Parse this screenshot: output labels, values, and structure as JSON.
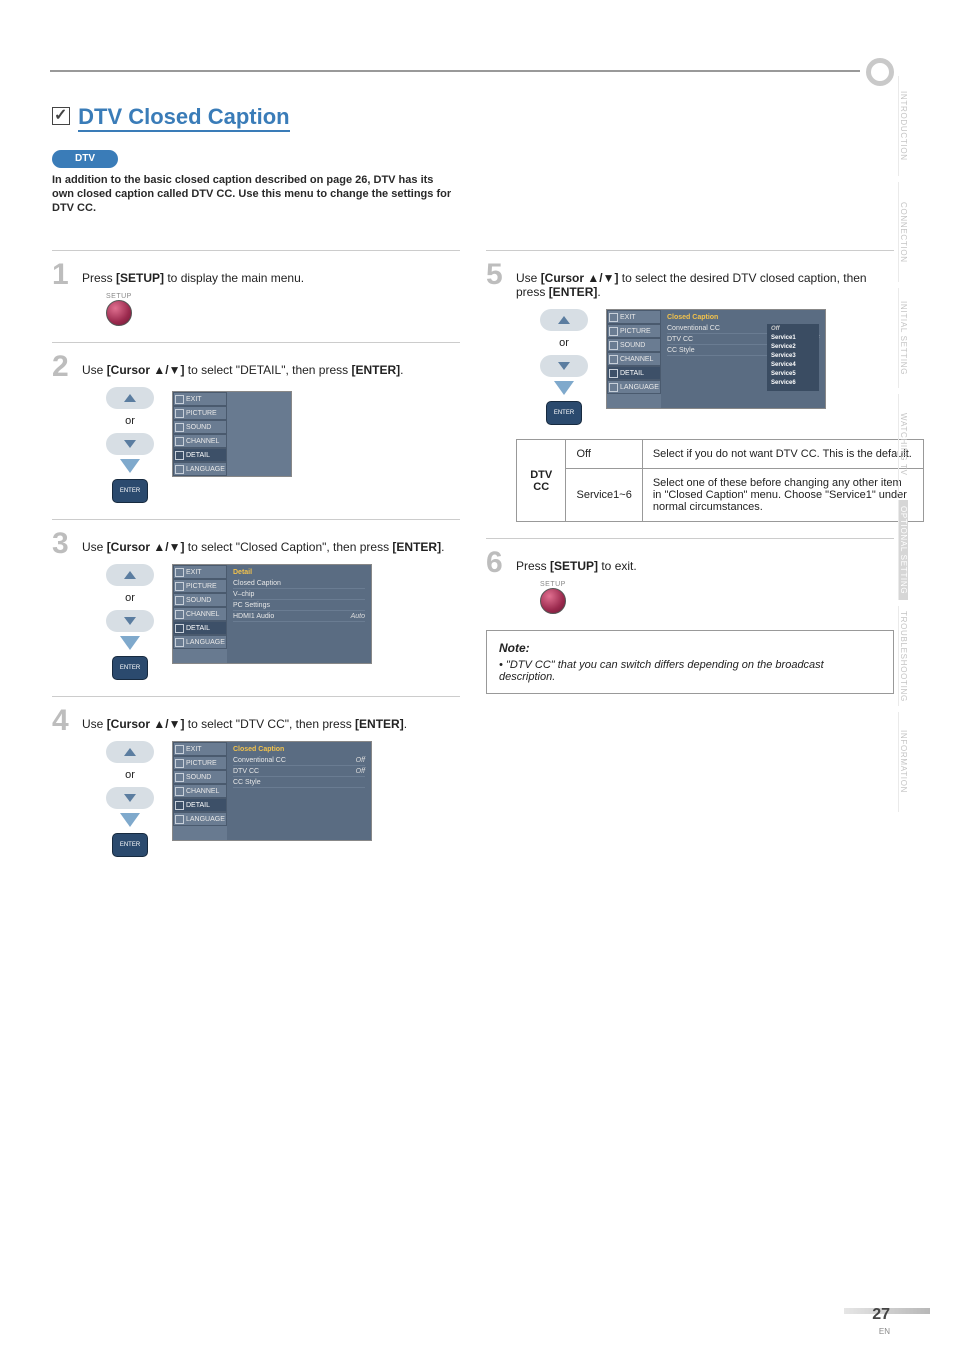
{
  "page": {
    "number": "27",
    "lang": "EN"
  },
  "title": {
    "prefix_icon": "checkbox",
    "text": "DTV Closed Caption"
  },
  "dtv_badge": "DTV",
  "intro": "In addition to the basic closed caption described on page 26, DTV has its own closed caption called DTV CC. Use this menu to change the settings for DTV CC.",
  "steps": {
    "s1": {
      "num": "1",
      "text_a": "Press ",
      "bold_a": "[SETUP]",
      "text_b": " to display the main menu.",
      "remote_label": "SETUP"
    },
    "s2": {
      "num": "2",
      "text_a": "Use ",
      "bold_a": "[Cursor ▲/▼]",
      "text_b": " to select \"DETAIL\", then press ",
      "bold_b": "[ENTER]",
      "tail": "."
    },
    "s3": {
      "num": "3",
      "text_a": "Use ",
      "bold_a": "[Cursor ▲/▼]",
      "text_b": " to select \"Closed Caption\", then press ",
      "bold_b": "[ENTER]",
      "tail": "."
    },
    "s4": {
      "num": "4",
      "text_a": "Use ",
      "bold_a": "[Cursor ▲/▼]",
      "text_b": " to select \"DTV CC\", then press ",
      "bold_b": "[ENTER]",
      "tail": "."
    },
    "s5": {
      "num": "5",
      "text_a": "Use ",
      "bold_a": "[Cursor ▲/▼]",
      "text_b": " to select the desired DTV closed caption, then press ",
      "bold_b": "[ENTER]",
      "tail": "."
    },
    "s6": {
      "num": "6",
      "text_a": "Press ",
      "bold_a": "[SETUP]",
      "text_b": " to exit.",
      "remote_label": "SETUP"
    }
  },
  "cursor": {
    "or": "or",
    "enter": "ENTER"
  },
  "osd_side": [
    "EXIT",
    "PICTURE",
    "SOUND",
    "CHANNEL",
    "DETAIL",
    "LANGUAGE"
  ],
  "osd3": {
    "header": "Detail",
    "rows": [
      {
        "l": "Closed Caption",
        "r": ""
      },
      {
        "l": "V–chip",
        "r": ""
      },
      {
        "l": "PC Settings",
        "r": ""
      },
      {
        "l": "HDMI1 Audio",
        "r": "Auto"
      }
    ]
  },
  "osd4": {
    "header": "Closed Caption",
    "rows": [
      {
        "l": "Conventional CC",
        "r": "Off"
      },
      {
        "l": "DTV CC",
        "r": "Off"
      },
      {
        "l": "CC Style",
        "r": ""
      }
    ]
  },
  "osd5": {
    "header": "Closed Caption",
    "rows": [
      {
        "l": "Conventional CC",
        "r": ""
      },
      {
        "l": "DTV CC",
        "r": "Off"
      },
      {
        "l": "CC Style",
        "r": ""
      }
    ],
    "submenu": [
      "Off",
      "Service1",
      "Service2",
      "Service3",
      "Service4",
      "Service5",
      "Service6"
    ]
  },
  "dtv_table": {
    "row_label": "DTV CC",
    "r1": {
      "opt": "Off",
      "desc": "Select if you do not want DTV CC. This is the default."
    },
    "r2": {
      "opt": "Service1~6",
      "desc": "Select one of these before changing any other item in \"Closed Caption\" menu. Choose \"Service1\" under normal circumstances."
    }
  },
  "note": {
    "title": "Note:",
    "item": "\"DTV CC\" that you can switch differs depending on the broadcast description."
  },
  "side_tabs": [
    "INTRODUCTION",
    "CONNECTION",
    "INITIAL SETTING",
    "WATCHING TV",
    "OPTIONAL SETTING",
    "TROUBLESHOOTING",
    "INFORMATION"
  ],
  "side_tabs_active_index": 4
}
